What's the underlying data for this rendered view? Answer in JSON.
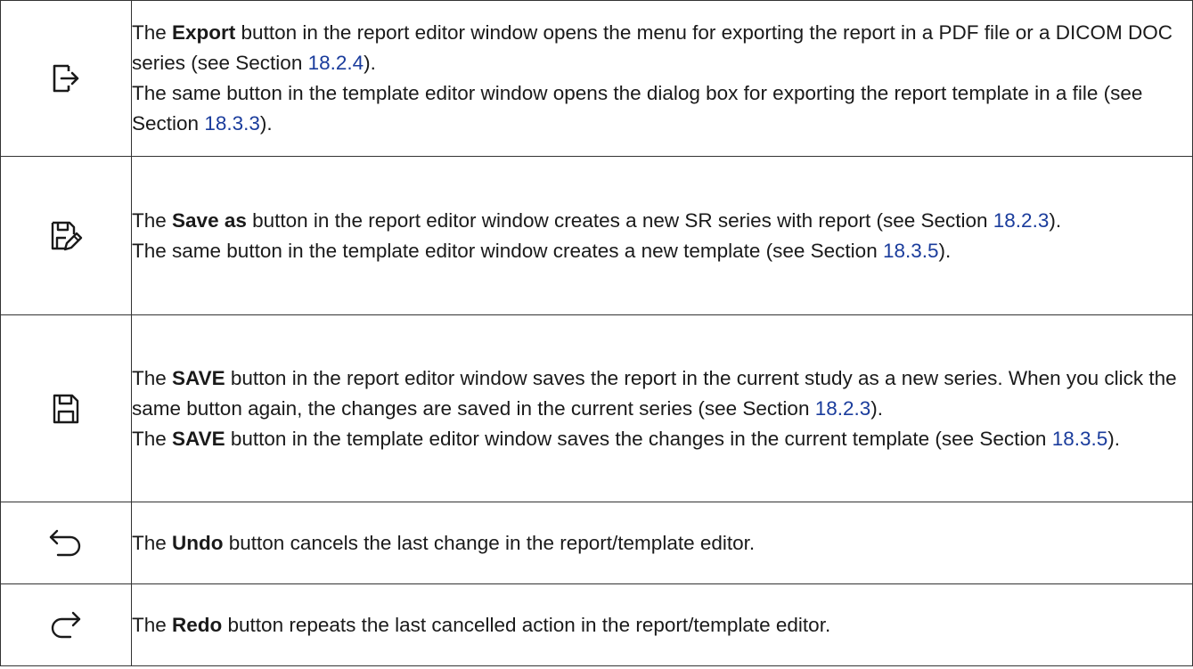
{
  "rows": [
    {
      "icon": "export-icon",
      "lines": [
        {
          "pre": "The ",
          "bold": "Export",
          "post": " button in the report editor window opens the menu for exporting the report in a PDF file or a DICOM DOC series (see Section ",
          "ref": "18.2.4",
          "end": ")."
        },
        {
          "pre": "The same button in the template editor window opens the dialog box for exporting the report template in a file (see Section ",
          "ref": "18.3.3",
          "end": ")."
        }
      ]
    },
    {
      "icon": "save-as-icon",
      "lines": [
        {
          "pre": "The ",
          "bold": "Save as",
          "post": " button in the report editor window creates a new SR series with report (see Section ",
          "ref": "18.2.3",
          "end": ")."
        },
        {
          "pre": "The same button in the template editor window creates a new template (see Section ",
          "ref": "18.3.5",
          "end": ")."
        }
      ]
    },
    {
      "icon": "save-icon",
      "lines": [
        {
          "pre": "The ",
          "bold": "SAVE",
          "post": " button in the report editor window saves the report in the current study as a new series. When you click the same button again, the changes are saved in the current series (see Section ",
          "ref": "18.2.3",
          "end": ")."
        },
        {
          "pre": "The ",
          "bold": "SAVE",
          "post": " button in the template editor window saves the changes in the current template (see Section ",
          "ref": "18.3.5",
          "end": ")."
        }
      ]
    },
    {
      "icon": "undo-icon",
      "lines": [
        {
          "pre": "The ",
          "bold": "Undo",
          "post": " button cancels the last change in the report/template editor."
        }
      ]
    },
    {
      "icon": "redo-icon",
      "lines": [
        {
          "pre": "The ",
          "bold": "Redo",
          "post": " button repeats the last cancelled action in the report/template editor."
        }
      ]
    }
  ]
}
